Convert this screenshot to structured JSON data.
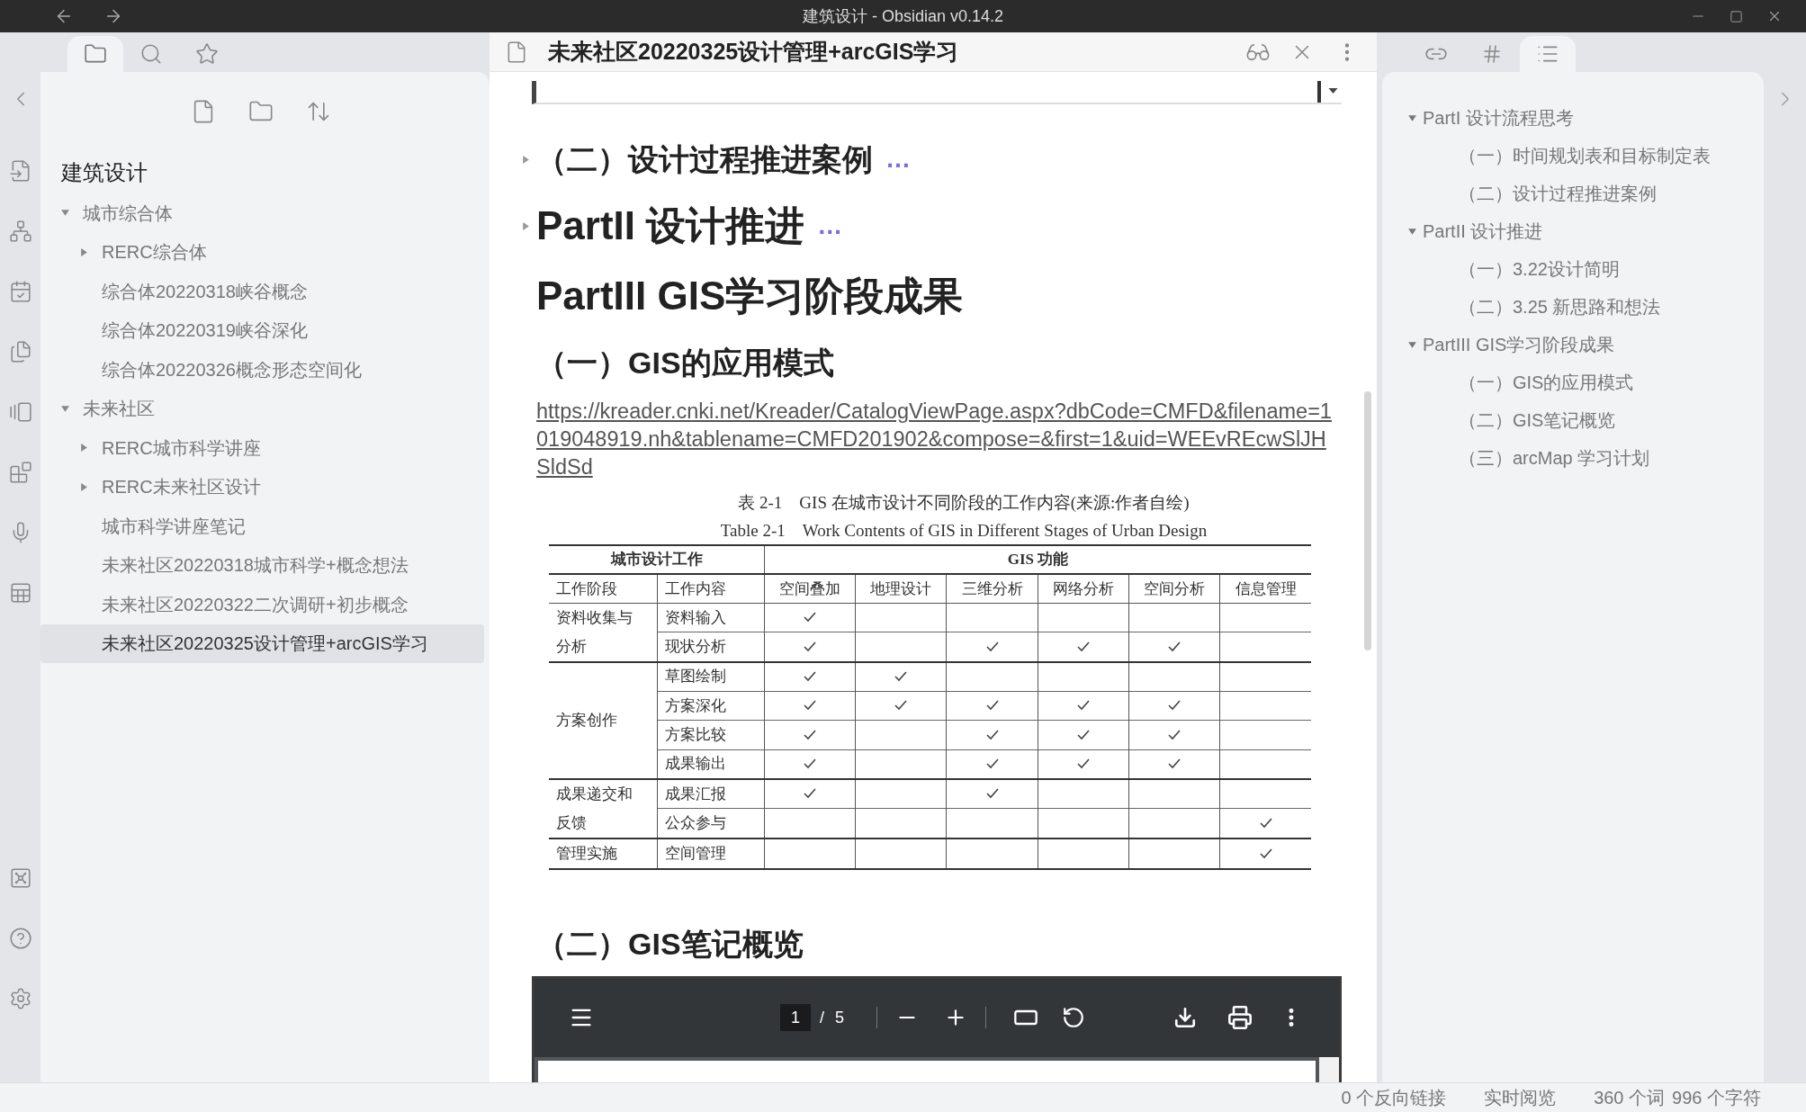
{
  "window": {
    "title": "建筑设计 - Obsidian v0.14.2"
  },
  "left_sidebar": {
    "vault_name": "建筑设计",
    "tree": [
      {
        "kind": "folder",
        "name": "城市综合体",
        "expanded": true,
        "selected": false,
        "children": [
          {
            "kind": "folder",
            "name": "RERC综合体",
            "expanded": false,
            "selected": false
          },
          {
            "kind": "file",
            "name": "综合体20220318峡谷概念",
            "selected": false
          },
          {
            "kind": "file",
            "name": "综合体20220319峡谷深化",
            "selected": false
          },
          {
            "kind": "file",
            "name": "综合体20220326概念形态空间化",
            "selected": false
          }
        ]
      },
      {
        "kind": "folder",
        "name": "未来社区",
        "expanded": true,
        "selected": false,
        "children": [
          {
            "kind": "folder",
            "name": "RERC城市科学讲座",
            "expanded": false,
            "selected": false
          },
          {
            "kind": "folder",
            "name": "RERC未来社区设计",
            "expanded": false,
            "selected": false
          },
          {
            "kind": "file",
            "name": "城市科学讲座笔记",
            "selected": false
          },
          {
            "kind": "file",
            "name": "未来社区20220318城市科学+概念想法",
            "selected": false
          },
          {
            "kind": "file",
            "name": "未来社区20220322二次调研+初步概念",
            "selected": false
          },
          {
            "kind": "file",
            "name": "未来社区20220325设计管理+arcGIS学习",
            "selected": true
          }
        ]
      }
    ]
  },
  "editor": {
    "tab_title": "未来社区20220325设计管理+arcGIS学习",
    "blocks": [
      {
        "kind": "embed_end"
      },
      {
        "kind": "h2",
        "text": "（二）设计过程推进案例",
        "collapsed": true,
        "fold_marker": "…"
      },
      {
        "kind": "h1",
        "text": "PartII 设计推进",
        "collapsed": true,
        "fold_marker": "…"
      },
      {
        "kind": "h1",
        "text": "PartIII GIS学习阶段成果",
        "collapsed": false
      },
      {
        "kind": "h2",
        "text": "（一）GIS的应用模式",
        "collapsed": false
      },
      {
        "kind": "link",
        "text": "https://kreader.cnki.net/Kreader/CatalogViewPage.aspx?dbCode=CMFD&filename=1019048919.nh&tablename=CMFD201902&compose=&first=1&uid=WEEvREcwSlJHSldSd"
      },
      {
        "kind": "figure"
      },
      {
        "kind": "h2",
        "text": "（二）GIS笔记概览",
        "collapsed": false
      },
      {
        "kind": "pdf"
      }
    ]
  },
  "figure": {
    "caption_zh": "表 2-1　GIS 在城市设计不同阶段的工作内容(来源:作者自绘)",
    "caption_en": "Table 2-1　Work Contents of GIS in Different Stages of Urban Design",
    "header_groups": [
      "城市设计工作",
      "GIS 功能"
    ],
    "columns": [
      "工作阶段",
      "工作内容",
      "空间叠加",
      "地理设计",
      "三维分析",
      "网络分析",
      "空间分析",
      "信息管理"
    ],
    "stages": [
      {
        "name": "资料收集与分析",
        "rows": [
          {
            "content": "资料输入",
            "ticks": [
              true,
              false,
              false,
              false,
              false,
              false
            ]
          },
          {
            "content": "现状分析",
            "ticks": [
              true,
              false,
              true,
              true,
              true,
              false
            ]
          }
        ]
      },
      {
        "name": "方案创作",
        "rows": [
          {
            "content": "草图绘制",
            "ticks": [
              true,
              true,
              false,
              false,
              false,
              false
            ]
          },
          {
            "content": "方案深化",
            "ticks": [
              true,
              true,
              true,
              true,
              true,
              false
            ]
          },
          {
            "content": "方案比较",
            "ticks": [
              true,
              false,
              true,
              true,
              true,
              false
            ]
          },
          {
            "content": "成果输出",
            "ticks": [
              true,
              false,
              true,
              true,
              true,
              false
            ]
          }
        ]
      },
      {
        "name": "成果递交和反馈",
        "rows": [
          {
            "content": "成果汇报",
            "ticks": [
              true,
              false,
              true,
              false,
              false,
              false
            ]
          },
          {
            "content": "公众参与",
            "ticks": [
              false,
              false,
              false,
              false,
              false,
              true
            ]
          }
        ]
      },
      {
        "name": "管理实施",
        "rows": [
          {
            "content": "空间管理",
            "ticks": [
              false,
              false,
              false,
              false,
              false,
              true
            ]
          }
        ]
      }
    ]
  },
  "pdf_viewer": {
    "page": "1",
    "separator": "/",
    "page_count": "5"
  },
  "outline": [
    {
      "text": "PartI 设计流程思考",
      "expanded": true,
      "children": [
        {
          "text": "（一）时间规划表和目标制定表"
        },
        {
          "text": "（二）设计过程推进案例"
        }
      ]
    },
    {
      "text": "PartII 设计推进",
      "expanded": true,
      "children": [
        {
          "text": "（一）3.22设计简明"
        },
        {
          "text": "（二）3.25 新思路和想法"
        }
      ]
    },
    {
      "text": "PartIII GIS学习阶段成果",
      "expanded": true,
      "children": [
        {
          "text": "（一）GIS的应用模式"
        },
        {
          "text": "（二）GIS笔记概览"
        },
        {
          "text": "（三）arcMap 学习计划"
        }
      ]
    }
  ],
  "status_bar": [
    "0 个反向链接",
    "实时阅览",
    "360 个词",
    "996 个字符"
  ]
}
